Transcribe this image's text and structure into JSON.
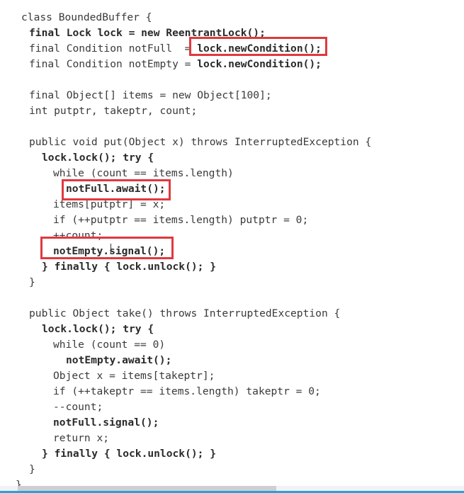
{
  "code": {
    "lines": [
      {
        "indent": 30,
        "segs": [
          {
            "t": "class BoundedBuffer {",
            "b": false
          }
        ]
      },
      {
        "indent": 41,
        "segs": [
          {
            "t": "final Lock lock = new ReentrantLock();",
            "b": true
          }
        ]
      },
      {
        "indent": 41,
        "segs": [
          {
            "t": "final Condition notFull  = ",
            "b": false
          },
          {
            "t": "lock.newCondition();",
            "b": true
          }
        ]
      },
      {
        "indent": 41,
        "segs": [
          {
            "t": "final Condition notEmpty = ",
            "b": false
          },
          {
            "t": "lock.newCondition();",
            "b": true
          }
        ]
      },
      {
        "indent": 41,
        "segs": []
      },
      {
        "indent": 41,
        "segs": [
          {
            "t": "final Object[] items = new Object[100];",
            "b": false
          }
        ]
      },
      {
        "indent": 41,
        "segs": [
          {
            "t": "int putptr, takeptr, count;",
            "b": false
          }
        ]
      },
      {
        "indent": 41,
        "segs": []
      },
      {
        "indent": 41,
        "segs": [
          {
            "t": "public void put(Object x) throws InterruptedException {",
            "b": false
          }
        ]
      },
      {
        "indent": 59,
        "segs": [
          {
            "t": "lock.lock(); try {",
            "b": true
          }
        ]
      },
      {
        "indent": 75,
        "segs": [
          {
            "t": "while (count == items.length)",
            "b": false
          }
        ]
      },
      {
        "indent": 93,
        "segs": [
          {
            "t": "notFull.await();",
            "b": true
          }
        ]
      },
      {
        "indent": 75,
        "segs": [
          {
            "t": "items[putptr] = x;",
            "b": false
          }
        ]
      },
      {
        "indent": 75,
        "segs": [
          {
            "t": "if (++putptr == items.length) putptr = 0;",
            "b": false
          }
        ]
      },
      {
        "indent": 75,
        "segs": [
          {
            "t": "++count;",
            "b": false
          }
        ]
      },
      {
        "indent": 75,
        "segs": [
          {
            "t": "notEmpty.signal();",
            "b": true
          }
        ]
      },
      {
        "indent": 59,
        "segs": [
          {
            "t": "} finally { lock.unlock(); }",
            "b": true
          }
        ]
      },
      {
        "indent": 41,
        "segs": [
          {
            "t": "}",
            "b": false
          }
        ]
      },
      {
        "indent": 41,
        "segs": []
      },
      {
        "indent": 41,
        "segs": [
          {
            "t": "public Object take() throws InterruptedException {",
            "b": false
          }
        ]
      },
      {
        "indent": 59,
        "segs": [
          {
            "t": "lock.lock(); try {",
            "b": true
          }
        ]
      },
      {
        "indent": 75,
        "segs": [
          {
            "t": "while (count == 0)",
            "b": false
          }
        ]
      },
      {
        "indent": 93,
        "segs": [
          {
            "t": "notEmpty.await();",
            "b": true
          }
        ]
      },
      {
        "indent": 75,
        "segs": [
          {
            "t": "Object x = items[takeptr];",
            "b": false
          }
        ]
      },
      {
        "indent": 75,
        "segs": [
          {
            "t": "if (++takeptr == items.length) takeptr = 0;",
            "b": false
          }
        ]
      },
      {
        "indent": 75,
        "segs": [
          {
            "t": "--count;",
            "b": false
          }
        ]
      },
      {
        "indent": 75,
        "segs": [
          {
            "t": "notFull.signal();",
            "b": true
          }
        ]
      },
      {
        "indent": 75,
        "segs": [
          {
            "t": "return x;",
            "b": false
          }
        ]
      },
      {
        "indent": 59,
        "segs": [
          {
            "t": "} finally { lock.unlock(); }",
            "b": true
          }
        ]
      },
      {
        "indent": 41,
        "segs": [
          {
            "t": "}",
            "b": false
          }
        ]
      },
      {
        "indent": 22,
        "segs": [
          {
            "t": "}",
            "b": false
          }
        ]
      }
    ]
  },
  "highlight_color": "#e0393e"
}
